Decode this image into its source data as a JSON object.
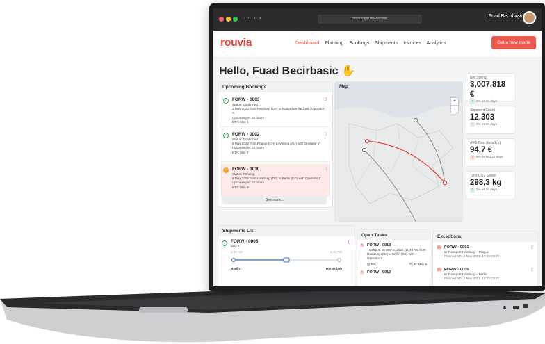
{
  "browser": {
    "url": "https://app.rouvia.com"
  },
  "header": {
    "user_name": "Fuad Becirbasic",
    "logo": "rouvia",
    "nav": [
      "Dashboard",
      "Planning",
      "Bookings",
      "Shipments",
      "Invoices",
      "Analytics"
    ],
    "quote_button": "Get a new quote"
  },
  "greeting": "Hello, Fuad Becirbasic",
  "bookings": {
    "title": "Upcoming Bookings",
    "see_more": "See more...",
    "items": [
      {
        "id": "FORW - 0003",
        "status_line": "Status: Confirmed",
        "route_line": "3 May 2022 from Hamburg (DE) to Rotterdam (NL) with Operator X",
        "upcoming": "Upcoming in: 24 hours",
        "eta": "ETA: May 4"
      },
      {
        "id": "FORW - 0002",
        "status_line": "Status: Confirmed",
        "route_line": "5 May 2022 from Prague (CH) to Vienna (AU) with Operator Y",
        "upcoming": "Upcoming in: 24 hours",
        "eta": "ETA: May 7"
      },
      {
        "id": "FORW - 0010",
        "status_line": "Status: Pending",
        "route_line": "8 May 2022 from Hamburg (DE) to Berlin (DE) with Operator Z",
        "upcoming": "Upcoming in: 24 hours",
        "eta": "ETA: May 9"
      }
    ]
  },
  "map": {
    "title": "Map",
    "zoom_in": "+",
    "zoom_out": "−"
  },
  "stats": [
    {
      "label": "Net Spend",
      "value": "3,007,818 €",
      "change": "2% vs 30 days",
      "trend": "up"
    },
    {
      "label": "Shipment Count",
      "value": "12,303",
      "change": "0% vs 30 days",
      "trend": "neutral"
    },
    {
      "label": "AVG Cost (tons/km)",
      "value": "94,7 €",
      "change": "8% vs last 30 days",
      "trend": "down"
    },
    {
      "label": "Tons CO2 Saved",
      "value": "298,3 kg",
      "change": "2% vs 30 days",
      "trend": "up"
    }
  ],
  "shipments": {
    "title": "Shipments List",
    "item": {
      "id": "FORW - 0005",
      "date": "May 2",
      "time_start": "3:40 AM",
      "time_end": "3:40 PM",
      "from": "Berlin",
      "to": "Rotterdam"
    }
  },
  "tasks": {
    "title": "Open Tasks",
    "items": [
      {
        "id": "FORW - 0010",
        "text": "Transport on May 8, 2022, 11:40 AM from Hamburg (DE) to Berlin (DE) with Operator X",
        "doc": "PAL",
        "due": "DUE: May 8"
      },
      {
        "id": "FORW - 0010"
      }
    ]
  },
  "exceptions": {
    "title": "Exceptions",
    "items": [
      {
        "id": "FORW - 0001",
        "line1": "In Transport Hamburg – Prague",
        "line2": "Planned ETA 2 May 2022, 17:03 CEST"
      },
      {
        "id": "FORW - 0005",
        "line1": "In Transport Hamburg – Berlin",
        "line2": "Planned ETA 2 May 2022, 18:03 CEST"
      }
    ]
  }
}
